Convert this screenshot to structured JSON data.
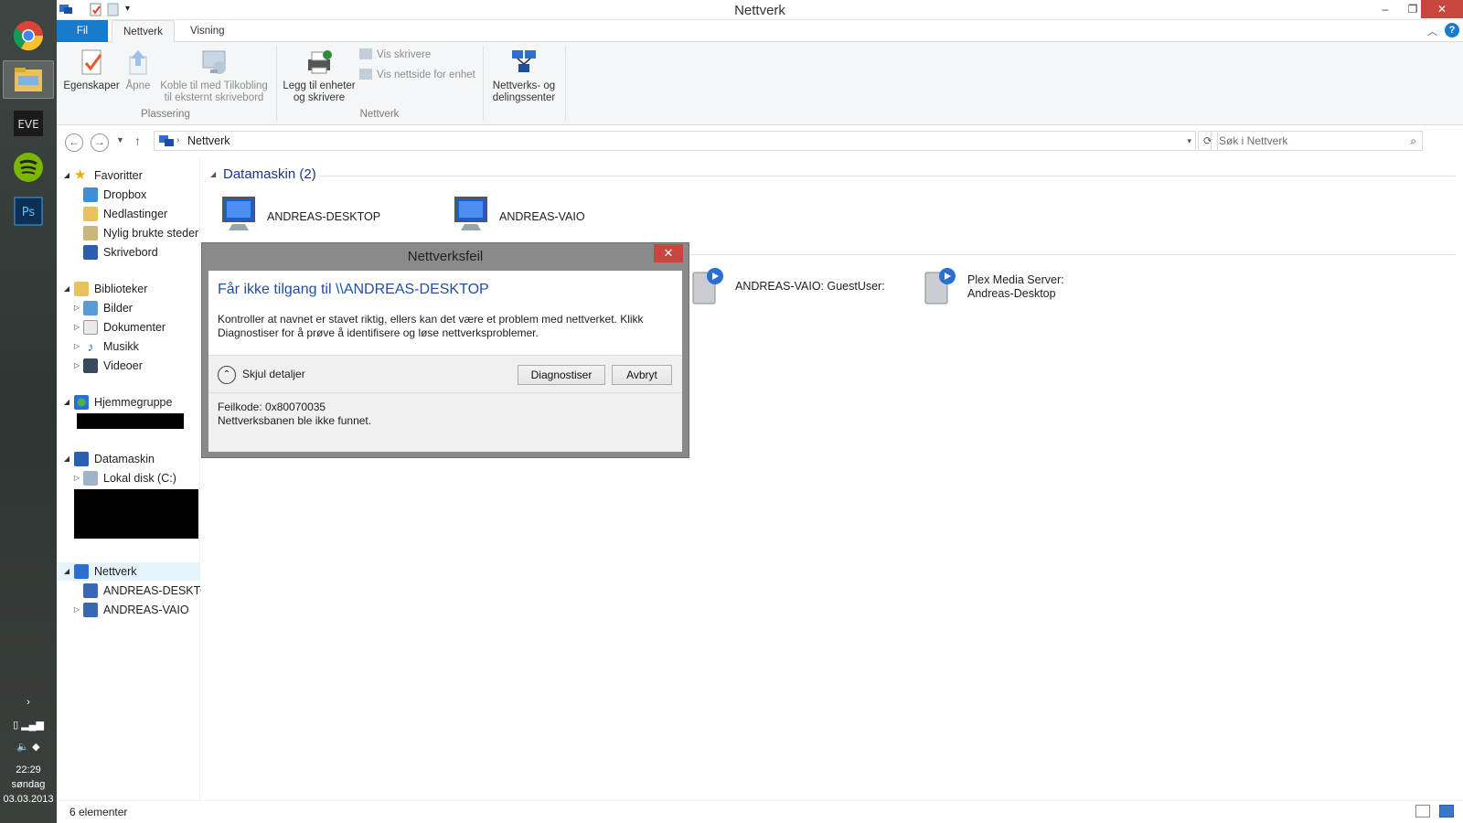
{
  "window": {
    "title": "Nettverk"
  },
  "ribbon": {
    "tabs": [
      {
        "label": "Fil"
      },
      {
        "label": "Nettverk"
      },
      {
        "label": "Visning"
      }
    ],
    "groups": [
      {
        "label": "Plassering",
        "buttons": [
          {
            "label": "Egenskaper",
            "icon": "properties-icon"
          },
          {
            "label": "Åpne",
            "icon": "open-icon"
          },
          {
            "label": "Koble til med Tilkobling til eksternt skrivebord",
            "icon": "remote-desktop-icon"
          }
        ]
      },
      {
        "label": "Nettverk",
        "buttons": [
          {
            "label": "Legg til enheter og skrivere",
            "icon": "printer-add-icon"
          },
          {
            "label": "Vis skrivere",
            "icon": "printer-icon"
          },
          {
            "label": "Vis nettside for enhet",
            "icon": "webpage-icon"
          }
        ]
      },
      {
        "label": "",
        "buttons": [
          {
            "label": "Nettverks- og delingssenter",
            "icon": "network-center-icon"
          }
        ]
      }
    ]
  },
  "address": {
    "path": "Nettverk",
    "search_placeholder": "Søk i Nettverk"
  },
  "nav": {
    "favorites": {
      "label": "Favoritter",
      "items": [
        "Dropbox",
        "Nedlastinger",
        "Nylig brukte steder",
        "Skrivebord"
      ]
    },
    "libraries": {
      "label": "Biblioteker",
      "items": [
        "Bilder",
        "Dokumenter",
        "Musikk",
        "Videoer"
      ]
    },
    "homegroup": {
      "label": "Hjemmegruppe"
    },
    "computer": {
      "label": "Datamaskin",
      "items": [
        "Lokal disk (C:)"
      ]
    },
    "network": {
      "label": "Nettverk",
      "items": [
        "ANDREAS-DESKTOP",
        "ANDREAS-VAIO"
      ]
    }
  },
  "content": {
    "group_computers": "Datamaskin (2)",
    "computers": [
      "ANDREAS-DESKTOP",
      "ANDREAS-VAIO"
    ],
    "media": [
      {
        "line1": "ANDREAS-VAIO: GuestUser:",
        "line2": ""
      },
      {
        "line1": "Plex Media Server:",
        "line2": "Andreas-Desktop"
      }
    ]
  },
  "status": {
    "count": "6 elementer"
  },
  "dialog": {
    "title": "Nettverksfeil",
    "heading": "Får ikke tilgang til \\\\ANDREAS-DESKTOP",
    "message": "Kontroller at navnet er stavet riktig, ellers kan det være et problem med nettverket. Klikk Diagnostiser for å prøve å identifisere og løse nettverksproblemer.",
    "toggle_label": "Skjul detaljer",
    "diagnose_label": "Diagnostiser",
    "cancel_label": "Avbryt",
    "error_code": "Feilkode: 0x80070035",
    "error_text": "Nettverksbanen ble ikke funnet."
  },
  "taskbar": {
    "time": "22:29",
    "day": "søndag",
    "date": "03.03.2013"
  },
  "colors": {
    "accent": "#1979ca",
    "heading": "#1e3287",
    "close": "#c7463d"
  }
}
